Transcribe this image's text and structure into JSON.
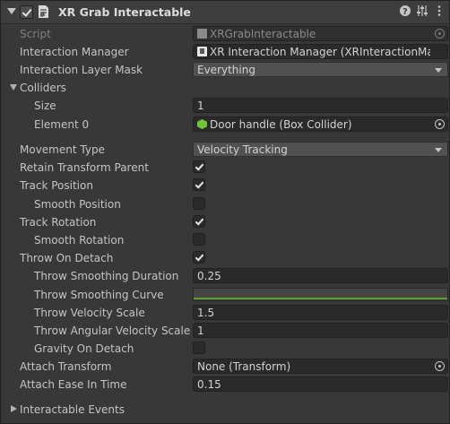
{
  "component": {
    "title": "XR Grab Interactable"
  },
  "fields": {
    "script_label": "Script",
    "script_value": "XRGrabInteractable",
    "interaction_manager_label": "Interaction Manager",
    "interaction_manager_value": "XR Interaction Manager (XRInteractionMana",
    "interaction_layer_mask_label": "Interaction Layer Mask",
    "interaction_layer_mask_value": "Everything",
    "colliders_label": "Colliders",
    "size_label": "Size",
    "size_value": "1",
    "element0_label": "Element 0",
    "element0_value": "Door handle (Box Collider)",
    "movement_type_label": "Movement Type",
    "movement_type_value": "Velocity Tracking",
    "retain_transform_parent_label": "Retain Transform Parent",
    "track_position_label": "Track Position",
    "smooth_position_label": "Smooth Position",
    "track_rotation_label": "Track Rotation",
    "smooth_rotation_label": "Smooth Rotation",
    "throw_on_detach_label": "Throw On Detach",
    "throw_smoothing_duration_label": "Throw Smoothing Duration",
    "throw_smoothing_duration_value": "0.25",
    "throw_smoothing_curve_label": "Throw Smoothing Curve",
    "throw_velocity_scale_label": "Throw Velocity Scale",
    "throw_velocity_scale_value": "1.5",
    "throw_angular_velocity_scale_label": "Throw Angular Velocity Scale",
    "throw_angular_velocity_scale_value": "1",
    "gravity_on_detach_label": "Gravity On Detach",
    "attach_transform_label": "Attach Transform",
    "attach_transform_value": "None (Transform)",
    "attach_ease_in_time_label": "Attach Ease In Time",
    "attach_ease_in_time_value": "0.15",
    "interactable_events_label": "Interactable Events"
  },
  "checkbox_states": {
    "component_enabled": true,
    "retain_transform_parent": true,
    "track_position": true,
    "smooth_position": false,
    "track_rotation": true,
    "smooth_rotation": false,
    "throw_on_detach": true,
    "gravity_on_detach": false
  },
  "colors": {
    "curve_line": "#5aa02c",
    "collider_icon": "#72c33a"
  },
  "icons": [
    "foldout-arrow-icon",
    "script-icon",
    "help-icon",
    "preset-icon",
    "more-menu-icon",
    "object-picker-icon",
    "box-collider-icon",
    "interaction-manager-icon",
    "dropdown-arrow-icon",
    "checkmark-icon"
  ]
}
